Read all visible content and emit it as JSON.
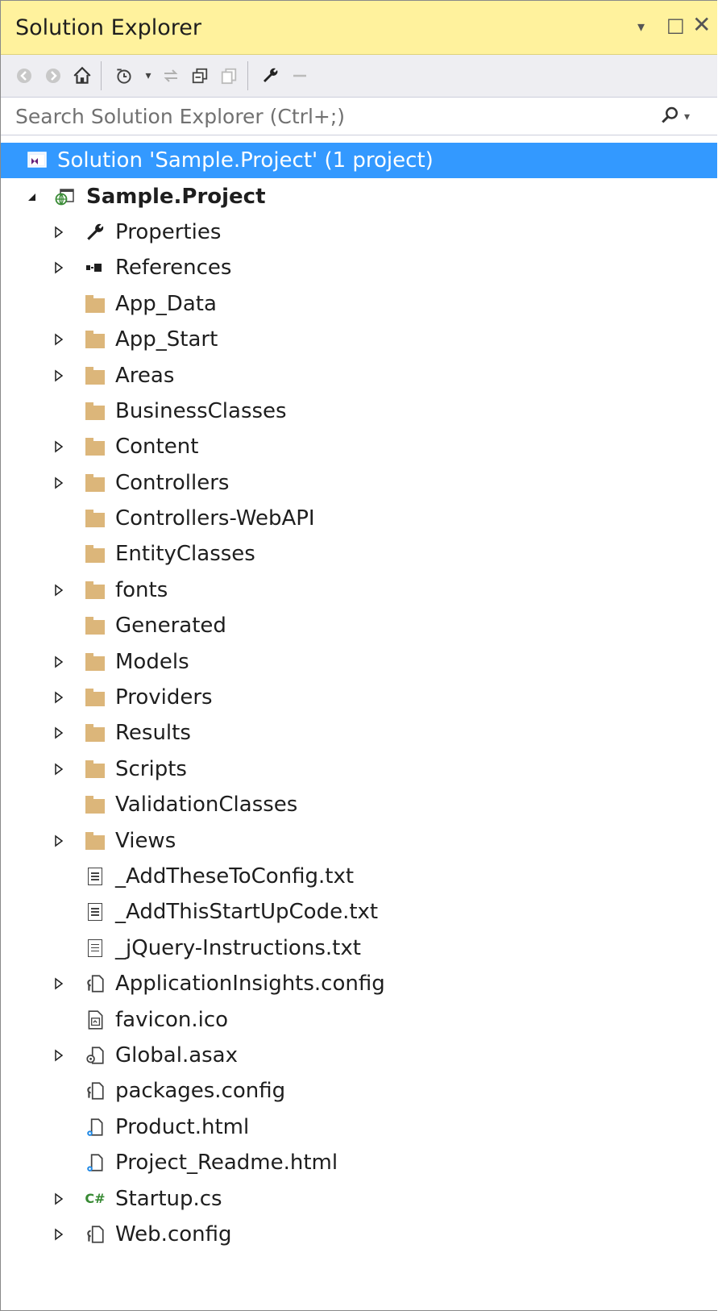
{
  "window": {
    "title": "Solution Explorer",
    "controls": {
      "dropdown": "▾",
      "maximize": "□",
      "close": "✕"
    }
  },
  "toolbar": {
    "buttons": [
      {
        "name": "back",
        "icon": "back-icon"
      },
      {
        "name": "forward",
        "icon": "forward-icon"
      },
      {
        "name": "home",
        "icon": "home-icon"
      },
      {
        "name": "pending-changes-filter",
        "icon": "clock-icon"
      },
      {
        "name": "sync-with-active-document",
        "icon": "sync-icon"
      },
      {
        "name": "collapse-all",
        "icon": "collapse-all-icon"
      },
      {
        "name": "show-all-files",
        "icon": "show-all-files-icon"
      },
      {
        "name": "properties",
        "icon": "wrench-icon"
      },
      {
        "name": "preview-selected",
        "icon": "dash-icon"
      }
    ]
  },
  "search": {
    "placeholder": "Search Solution Explorer (Ctrl+;)"
  },
  "tree": {
    "solution": {
      "label": "Solution 'Sample.Project' (1 project)",
      "icon": "solution-icon"
    },
    "project": {
      "label": "Sample.Project",
      "icon": "web-project-icon",
      "expanded": true
    },
    "items": [
      {
        "label": "Properties",
        "icon": "wrench-icon",
        "expandable": true
      },
      {
        "label": "References",
        "icon": "references-icon",
        "expandable": true
      },
      {
        "label": "App_Data",
        "icon": "folder-icon",
        "expandable": false
      },
      {
        "label": "App_Start",
        "icon": "folder-icon",
        "expandable": true
      },
      {
        "label": "Areas",
        "icon": "folder-icon",
        "expandable": true
      },
      {
        "label": "BusinessClasses",
        "icon": "folder-icon",
        "expandable": false
      },
      {
        "label": "Content",
        "icon": "folder-icon",
        "expandable": true
      },
      {
        "label": "Controllers",
        "icon": "folder-icon",
        "expandable": true
      },
      {
        "label": "Controllers-WebAPI",
        "icon": "folder-icon",
        "expandable": false
      },
      {
        "label": "EntityClasses",
        "icon": "folder-icon",
        "expandable": false
      },
      {
        "label": "fonts",
        "icon": "folder-icon",
        "expandable": true
      },
      {
        "label": "Generated",
        "icon": "folder-icon",
        "expandable": false
      },
      {
        "label": "Models",
        "icon": "folder-icon",
        "expandable": true
      },
      {
        "label": "Providers",
        "icon": "folder-icon",
        "expandable": true
      },
      {
        "label": "Results",
        "icon": "folder-icon",
        "expandable": true
      },
      {
        "label": "Scripts",
        "icon": "folder-icon",
        "expandable": true
      },
      {
        "label": "ValidationClasses",
        "icon": "folder-icon",
        "expandable": false
      },
      {
        "label": "Views",
        "icon": "folder-icon",
        "expandable": true
      },
      {
        "label": "_AddTheseToConfig.txt",
        "icon": "text-file-icon",
        "expandable": false
      },
      {
        "label": "_AddThisStartUpCode.txt",
        "icon": "text-file-icon",
        "expandable": false
      },
      {
        "label": "_jQuery-Instructions.txt",
        "icon": "text-file-icon",
        "expandable": false
      },
      {
        "label": "ApplicationInsights.config",
        "icon": "config-file-icon",
        "expandable": true
      },
      {
        "label": "favicon.ico",
        "icon": "image-file-icon",
        "expandable": false
      },
      {
        "label": "Global.asax",
        "icon": "asax-file-icon",
        "expandable": true
      },
      {
        "label": "packages.config",
        "icon": "config-file-icon",
        "expandable": false
      },
      {
        "label": "Product.html",
        "icon": "html-file-icon",
        "expandable": false
      },
      {
        "label": "Project_Readme.html",
        "icon": "html-file-icon",
        "expandable": false
      },
      {
        "label": "Startup.cs",
        "icon": "csharp-file-icon",
        "expandable": true,
        "icon_text": "C#"
      },
      {
        "label": "Web.config",
        "icon": "config-file-icon",
        "expandable": true
      }
    ]
  },
  "colors": {
    "titlebar": "#fff29d",
    "selection": "#3399ff",
    "folder": "#dcb67a",
    "toolbar": "#eeeef2"
  }
}
